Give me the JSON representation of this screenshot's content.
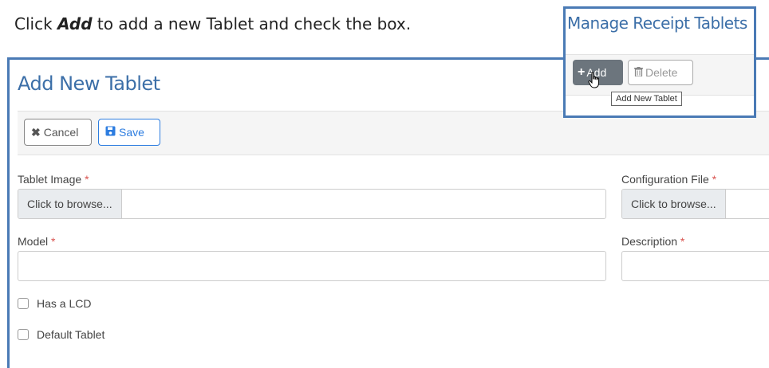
{
  "instruction": {
    "prefix": "Click ",
    "action": "Add",
    "suffix": " to add a new Tablet and check the box."
  },
  "form": {
    "title": "Add New Tablet",
    "toolbar": {
      "cancel_label": "Cancel",
      "save_label": "Save"
    },
    "fields": {
      "tablet_image": {
        "label": "Tablet Image",
        "required": "*",
        "browse_label": "Click to browse..."
      },
      "configuration_file": {
        "label": "Configuration File",
        "required": "*",
        "browse_label": "Click to browse..."
      },
      "model": {
        "label": "Model",
        "required": "*",
        "value": ""
      },
      "description": {
        "label": "Description",
        "required": "*",
        "value": ""
      }
    },
    "checkboxes": [
      {
        "label": "Has a LCD",
        "checked": false
      },
      {
        "label": "Default Tablet",
        "checked": false
      }
    ]
  },
  "inset": {
    "title": "Manage Receipt Tablets",
    "add_label": "Add",
    "delete_label": "Delete",
    "tooltip": "Add New Tablet"
  },
  "colors": {
    "accent_border": "#4a7ab5",
    "title_blue": "#3c6fa8",
    "save_blue": "#2d7de0",
    "add_button_bg": "#6c757d",
    "required_red": "#d9534f"
  },
  "icons": {
    "cancel": "times-icon",
    "save": "floppy-disk-icon",
    "add": "plus-icon",
    "delete": "trash-icon",
    "cursor": "hand-pointer-icon"
  }
}
